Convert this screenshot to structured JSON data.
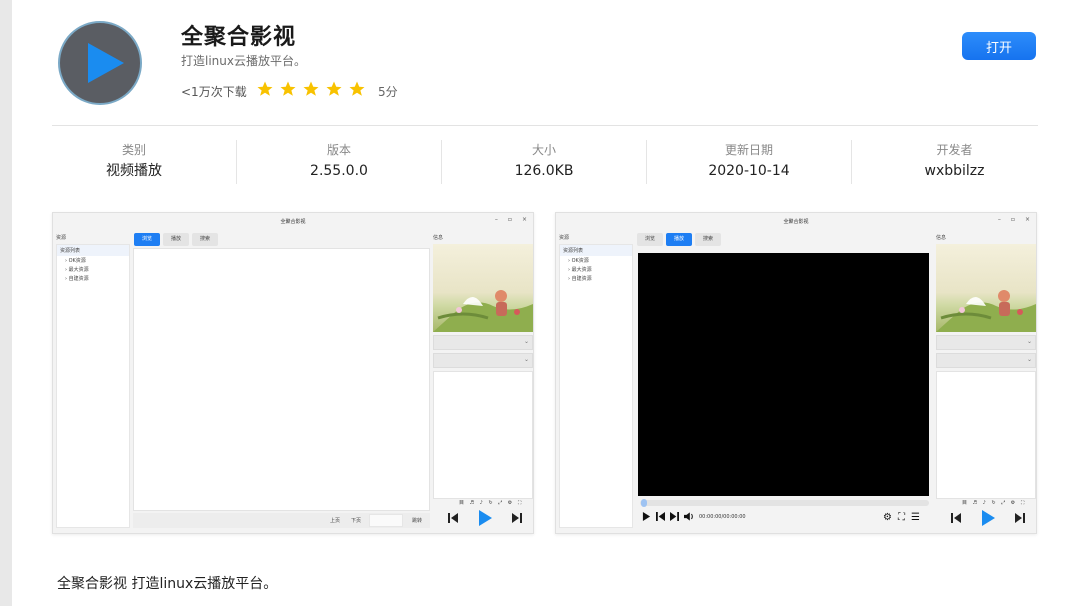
{
  "app": {
    "name": "全聚合影视",
    "subtitle": "打造linux云播放平台。",
    "downloads": "<1万次下载",
    "rating_stars": 5,
    "rating_text": "5分",
    "open_button": "打开",
    "colors": {
      "accent": "#1a7ef2",
      "star": "#f8c200",
      "icon_bg": "#5a5d63",
      "play": "#1a8cf0"
    }
  },
  "info": [
    {
      "label": "类别",
      "value": "视频播放"
    },
    {
      "label": "版本",
      "value": "2.55.0.0"
    },
    {
      "label": "大小",
      "value": "126.0KB"
    },
    {
      "label": "更新日期",
      "value": "2020-10-14"
    },
    {
      "label": "开发者",
      "value": "wxbbilzz"
    }
  ],
  "screenshots": [
    {
      "window_title": "全聚合影视",
      "left_label": "资源",
      "tree_root": "资源列表",
      "tree_items": [
        "OK资源",
        "最大资源",
        "自建资源"
      ],
      "tabs": [
        "浏览",
        "播放",
        "搜索"
      ],
      "active_tab": 0,
      "right_label": "信息",
      "pager": {
        "prev": "上页",
        "next": "下页",
        "go": "跳转"
      },
      "mini_controls": "目 ♬ ♪ ↻ ⤢ ⚙ ⛶"
    },
    {
      "window_title": "全聚合影视",
      "left_label": "资源",
      "tree_root": "资源列表",
      "tree_items": [
        "OK资源",
        "最大资源",
        "自建资源"
      ],
      "tabs": [
        "浏览",
        "播放",
        "搜索"
      ],
      "active_tab": 1,
      "right_label": "信息",
      "time": "00:00:00/00:00:00",
      "mini_controls": "目 ♬ ♪ ↻ ⤢ ⚙ ⛶"
    }
  ],
  "description": "全聚合影视 打造linux云播放平台。"
}
